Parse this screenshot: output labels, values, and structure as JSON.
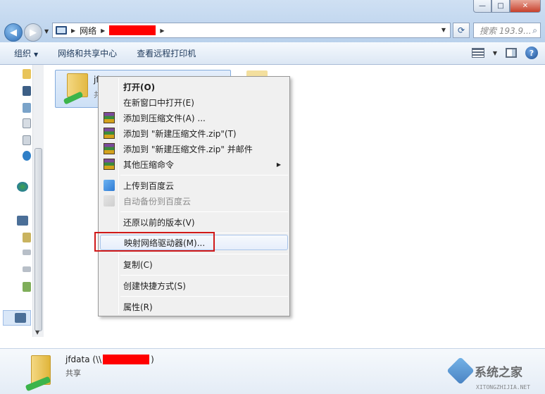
{
  "address_bar": {
    "root": "网络",
    "search_placeholder": "搜索 193.9..."
  },
  "window_controls": {
    "minimize": "—",
    "maximize": "□",
    "close": "✕"
  },
  "toolbar": {
    "organize": "组织",
    "network_center": "网络和共享中心",
    "remote_printer": "查看远程打印机",
    "help": "?"
  },
  "selected_item": {
    "name": "jf",
    "sub": "共"
  },
  "context_menu": {
    "items": [
      {
        "label": "打开(O)",
        "bold": true
      },
      {
        "label": "在新窗口中打开(E)"
      },
      {
        "label": "添加到压缩文件(A) ..."
      },
      {
        "label": "添加到 \"新建压缩文件.zip\"(T)"
      },
      {
        "label": "添加到 \"新建压缩文件.zip\" 并邮件"
      },
      {
        "label": "其他压缩命令"
      },
      {
        "label": "上传到百度云"
      },
      {
        "label": "自动备份到百度云"
      },
      {
        "label": "还原以前的版本(V)"
      },
      {
        "label": "映射网络驱动器(M)..."
      },
      {
        "label": "复制(C)"
      },
      {
        "label": "创建快捷方式(S)"
      },
      {
        "label": "属性(R)"
      }
    ]
  },
  "details": {
    "name_prefix": "jfdata (\\\\",
    "name_suffix": ")",
    "sub": "共享"
  },
  "watermark": {
    "text": "系统之家",
    "url": "XITONGZHIJIA.NET"
  }
}
